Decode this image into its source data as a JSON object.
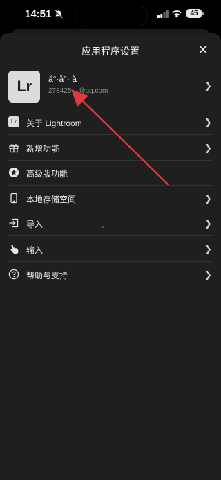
{
  "status_bar": {
    "time": "14:51",
    "battery": "45"
  },
  "settings": {
    "title": "应用程序设置",
    "close_label": "✕"
  },
  "account": {
    "logo_text": "Lr",
    "name": "å°·å°· å",
    "email": "278425…@qq.com"
  },
  "menu": [
    {
      "icon": "lightroom-icon",
      "label": "关于 Lightroom"
    },
    {
      "icon": "gift-icon",
      "label": "新增功能"
    },
    {
      "icon": "star-badge-icon",
      "label": "高级版功能"
    },
    {
      "icon": "phone-icon",
      "label": "本地存储空间"
    },
    {
      "icon": "import-icon",
      "label": "导入"
    },
    {
      "icon": "hand-pointer-icon",
      "label": "输入"
    },
    {
      "icon": "help-icon",
      "label": "帮助与支持"
    }
  ],
  "colors": {
    "sheet_bg": "#1f1f1f",
    "annotation_arrow": "#e0393e"
  }
}
